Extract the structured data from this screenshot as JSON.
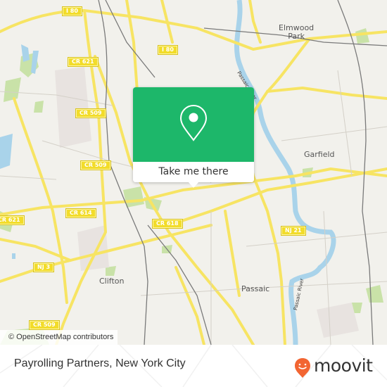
{
  "map": {
    "place_labels": [
      {
        "id": "elmwood-park",
        "line1": "Elmwood",
        "line2": "Park"
      },
      {
        "id": "garfield",
        "text": "Garfield"
      },
      {
        "id": "clifton",
        "text": "Clifton"
      },
      {
        "id": "passaic",
        "text": "Passaic"
      }
    ],
    "road_shields": [
      "I 80",
      "I 80",
      "CR 621",
      "CR 509",
      "CR 509",
      "CR 614",
      "CR 621",
      "CR 618",
      "NJ 21",
      "NJ 3",
      "CR 509"
    ],
    "river_labels": [
      "Passaic River",
      "Passaic River"
    ],
    "colors": {
      "background": "#f2f1ec",
      "road": "#f7e463",
      "water": "#a9d3ea",
      "park": "#c9e2a8",
      "rail": "#777777"
    }
  },
  "popup": {
    "icon": "location-pin-icon",
    "button_label": "Take me there",
    "accent_color": "#1db76a"
  },
  "attribution": "© OpenStreetMap contributors",
  "footer": {
    "title": "Payrolling Partners, New York City",
    "brand": "moovit",
    "brand_color": "#f26532"
  }
}
